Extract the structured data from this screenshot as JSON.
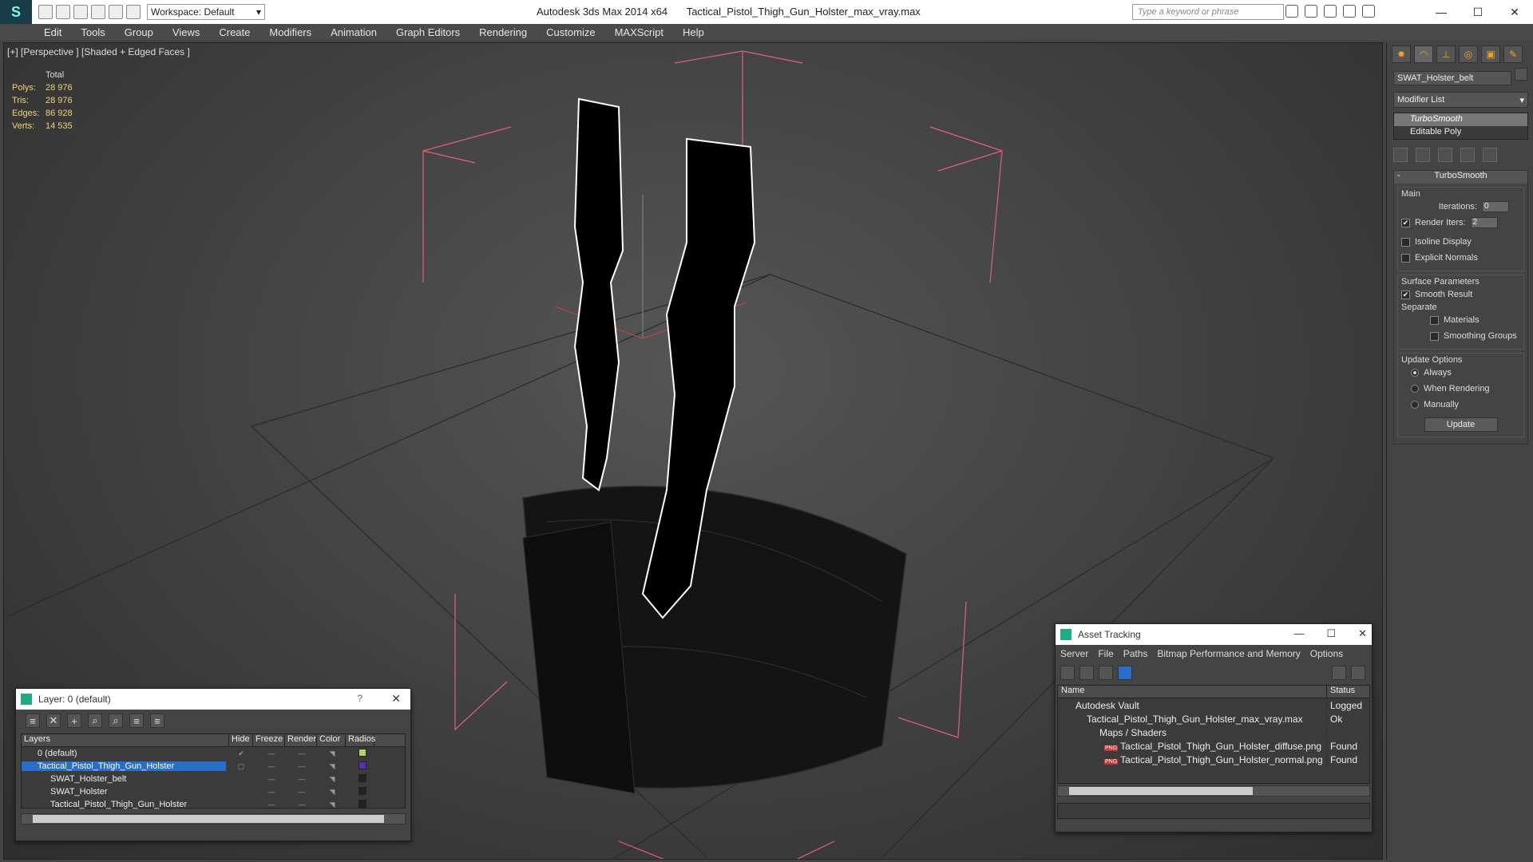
{
  "titlebar": {
    "app": "Autodesk 3ds Max  2014 x64",
    "file": "Tactical_Pistol_Thigh_Gun_Holster_max_vray.max",
    "workspace": "Workspace: Default",
    "search_placeholder": "Type a keyword or phrase"
  },
  "menu": [
    "Edit",
    "Tools",
    "Group",
    "Views",
    "Create",
    "Modifiers",
    "Animation",
    "Graph Editors",
    "Rendering",
    "Customize",
    "MAXScript",
    "Help"
  ],
  "viewport": {
    "label": "[+] [Perspective ] [Shaded + Edged Faces ]",
    "stats": {
      "header": "Total",
      "rows": [
        {
          "k": "Polys:",
          "v": "28 976"
        },
        {
          "k": "Tris:",
          "v": "28 976"
        },
        {
          "k": "Edges:",
          "v": "86 928"
        },
        {
          "k": "Verts:",
          "v": "14 535"
        }
      ]
    }
  },
  "command_panel": {
    "object_name": "SWAT_Holster_belt",
    "modifier_list": "Modifier List",
    "stack": [
      "TurboSmooth",
      "Editable Poly"
    ],
    "rollout_title": "TurboSmooth",
    "main_group": "Main",
    "iterations_label": "Iterations:",
    "iterations_value": "0",
    "render_iters_label": "Render Iters:",
    "render_iters_value": "2",
    "isoline_label": "Isoline Display",
    "explicit_normals_label": "Explicit Normals",
    "surface_group": "Surface Parameters",
    "smooth_result_label": "Smooth Result",
    "separate_label": "Separate",
    "materials_label": "Materials",
    "smoothing_groups_label": "Smoothing Groups",
    "update_group": "Update Options",
    "always_label": "Always",
    "when_rendering_label": "When Rendering",
    "manually_label": "Manually",
    "update_button": "Update"
  },
  "layer_window": {
    "title": "Layer: 0 (default)",
    "help": "?",
    "columns": [
      "Layers",
      "Hide",
      "Freeze",
      "Render",
      "Color",
      "Radios"
    ],
    "rows": [
      {
        "name": "0 (default)",
        "color": "#b5d36c"
      },
      {
        "name": "Tactical_Pistol_Thigh_Gun_Holster",
        "color": "#5b2fb8"
      },
      {
        "name": "SWAT_Holster_belt",
        "color": "#222222"
      },
      {
        "name": "SWAT_Holster",
        "color": "#222222"
      },
      {
        "name": "Tactical_Pistol_Thigh_Gun_Holster",
        "color": "#222222"
      }
    ]
  },
  "asset_window": {
    "title": "Asset Tracking",
    "menu": [
      "Server",
      "File",
      "Paths",
      "Bitmap Performance and Memory",
      "Options"
    ],
    "columns": [
      "Name",
      "Status"
    ],
    "rows": [
      {
        "name": "Autodesk Vault",
        "status": "Logged"
      },
      {
        "name": "Tactical_Pistol_Thigh_Gun_Holster_max_vray.max",
        "status": "Ok"
      },
      {
        "name": "Maps / Shaders",
        "status": ""
      },
      {
        "name": "Tactical_Pistol_Thigh_Gun_Holster_diffuse.png",
        "status": "Found"
      },
      {
        "name": "Tactical_Pistol_Thigh_Gun_Holster_normal.png",
        "status": "Found"
      }
    ]
  },
  "colors": {
    "accent": "#2b6ec9",
    "stats": "#f1d37a",
    "bbox": "#e0607a"
  }
}
